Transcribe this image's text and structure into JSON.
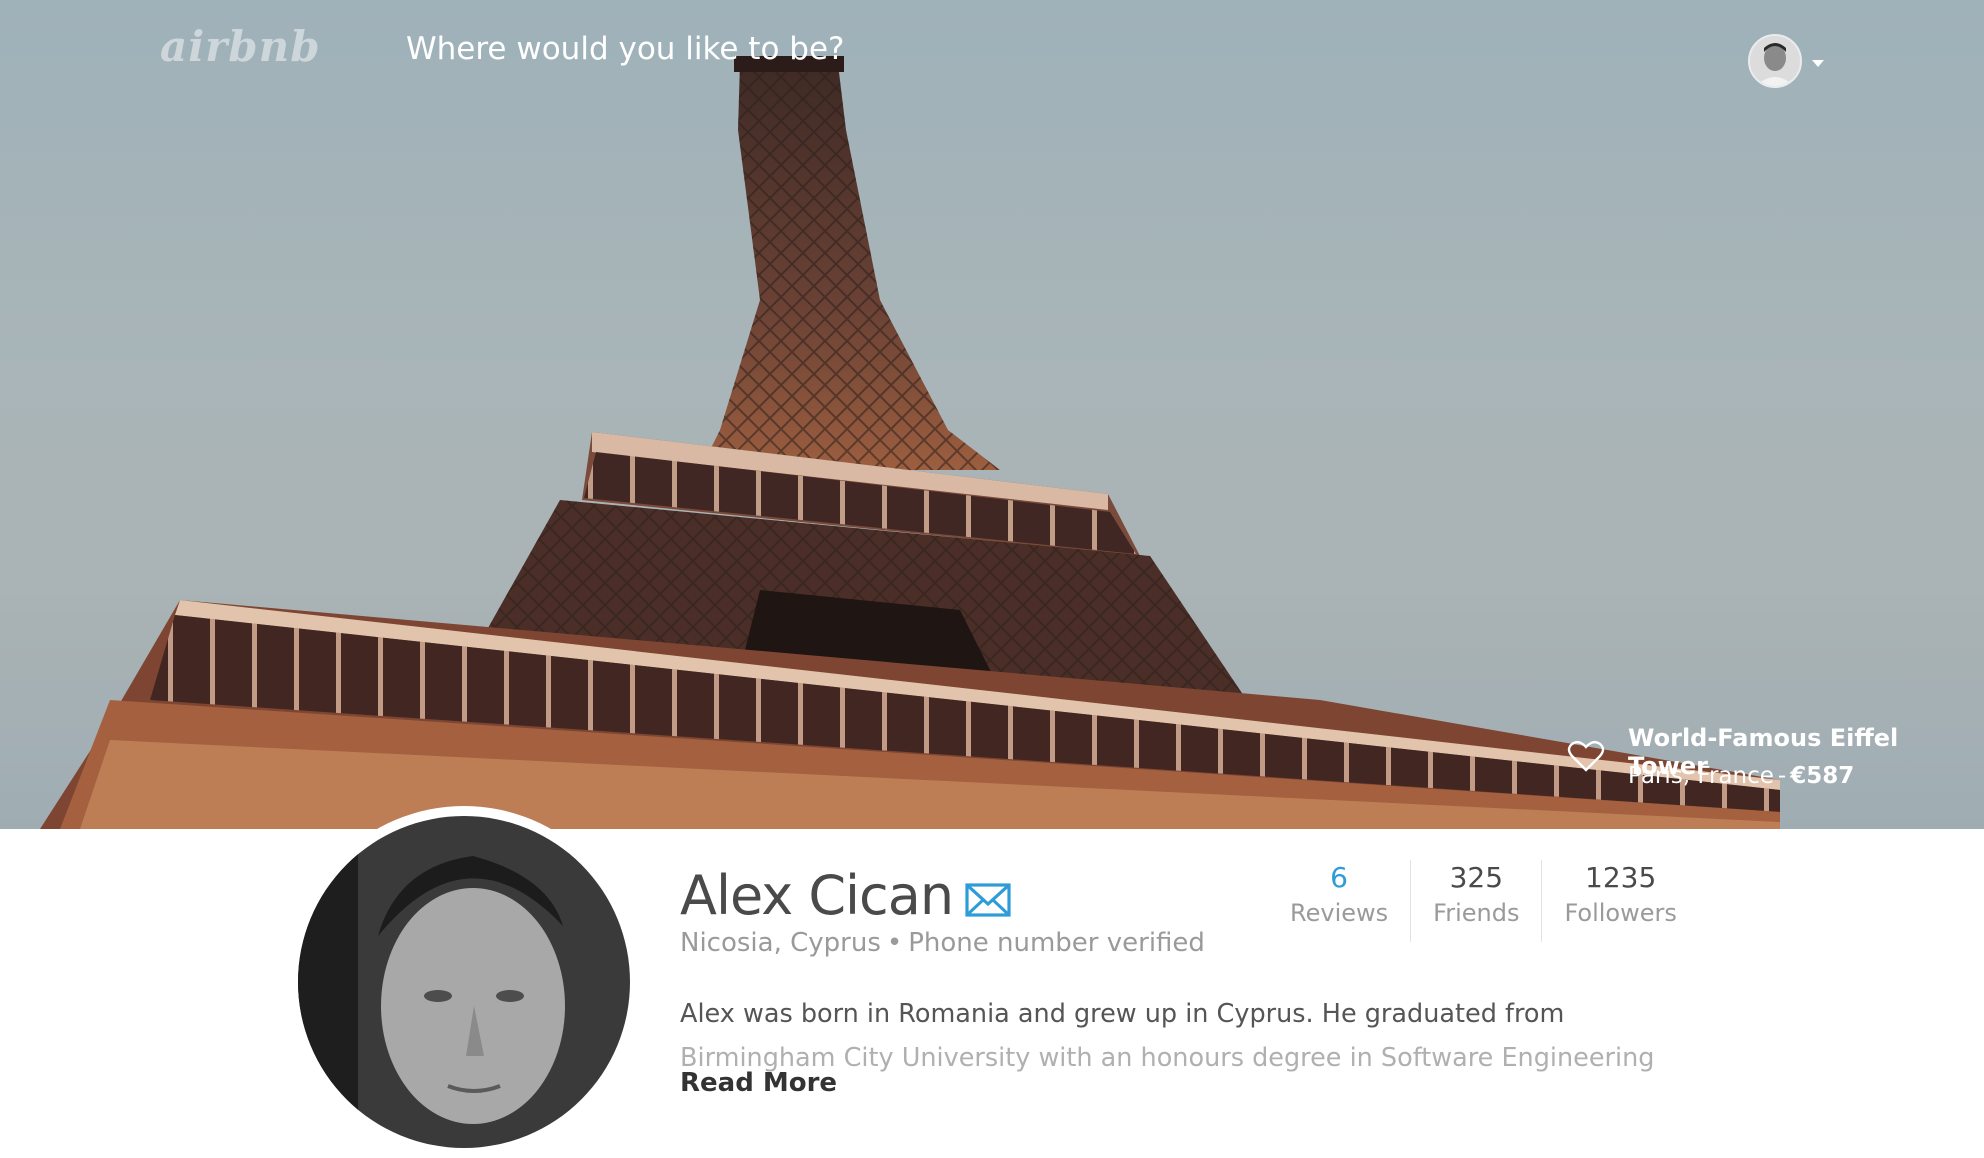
{
  "header": {
    "logo_text": "airbnb",
    "search_placeholder": "Where would you like to be?",
    "user_avatar_icon": "user-avatar-icon",
    "menu_icon": "chevron-down-icon"
  },
  "hero": {
    "image_subject": "eiffel-tower-photo",
    "listing": {
      "title": "World-Famous Eiffel Tower",
      "location": "Paris, France",
      "separator": "-",
      "price": "€587",
      "favorite_icon": "heart-icon"
    }
  },
  "profile": {
    "name": "Alex Cican",
    "message_icon": "mail-icon",
    "location": "Nicosia, Cyprus",
    "bullet": "•",
    "verification": "Phone number verified",
    "stats": [
      {
        "value": "6",
        "label": "Reviews"
      },
      {
        "value": "325",
        "label": "Friends"
      },
      {
        "value": "1235",
        "label": "Followers"
      }
    ],
    "bio_line1": "Alex was born in Romania and grew up in Cyprus. He graduated from",
    "bio_line2": "Birmingham City University with an honours degree in Software Engineering",
    "read_more": "Read More"
  },
  "colors": {
    "accent": "#2d9cd8",
    "text_dark": "#4a4a4a",
    "text_muted": "#9a9a9a",
    "sky": "#a6b4b8",
    "tower": "#5a3a30"
  }
}
